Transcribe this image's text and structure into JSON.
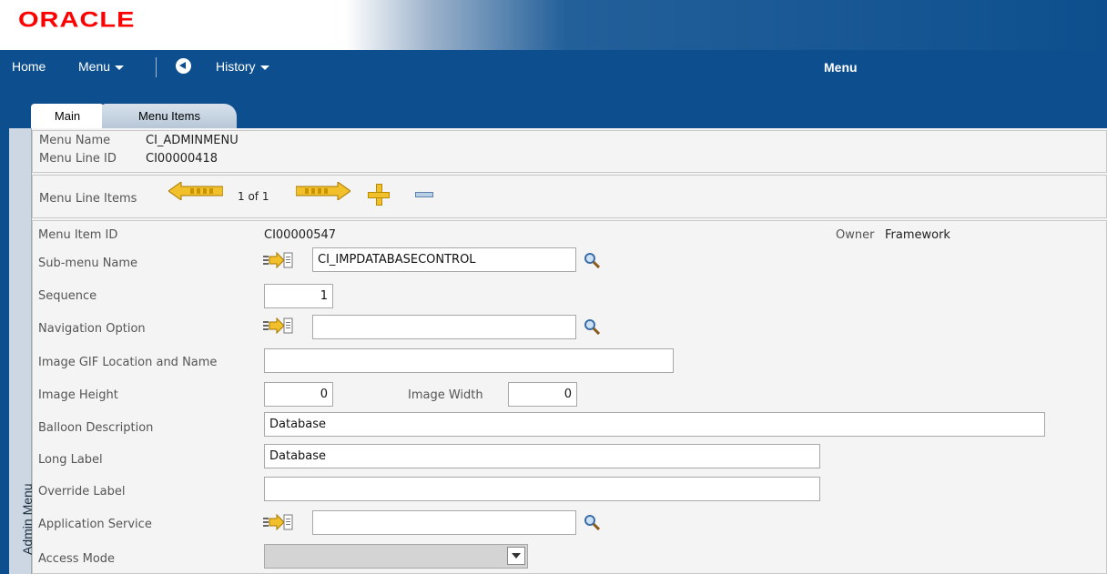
{
  "brand": {
    "logo": "ORACLE"
  },
  "nav": {
    "home": "Home",
    "menu": "Menu",
    "history": "History",
    "page_title": "Menu"
  },
  "tabs": [
    {
      "label": "Main"
    },
    {
      "label": "Menu Items"
    }
  ],
  "side_tab": {
    "label": "Admin Menu"
  },
  "header": {
    "menu_name_label": "Menu Name",
    "menu_name_value": "CI_ADMINMENU",
    "menu_line_id_label": "Menu Line ID",
    "menu_line_id_value": "CI00000418"
  },
  "line_items": {
    "label": "Menu Line Items",
    "pager": "1 of 1"
  },
  "form": {
    "menu_item_id_label": "Menu Item ID",
    "menu_item_id_value": "CI00000547",
    "owner_label": "Owner",
    "owner_value": "Framework",
    "submenu_label": "Sub-menu Name",
    "submenu_value": "CI_IMPDATABASECONTROL",
    "sequence_label": "Sequence",
    "sequence_value": "1",
    "nav_option_label": "Navigation Option",
    "nav_option_value": "",
    "image_gif_label": "Image GIF Location and Name",
    "image_gif_value": "",
    "image_height_label": "Image Height",
    "image_height_value": "0",
    "image_width_label": "Image Width",
    "image_width_value": "0",
    "balloon_label": "Balloon Description",
    "balloon_value": "Database",
    "long_label_label": "Long Label",
    "long_label_value": "Database",
    "override_label": "Override Label",
    "override_value": "",
    "app_service_label": "Application Service",
    "app_service_value": "",
    "access_mode_label": "Access Mode",
    "access_mode_value": ""
  },
  "colors": {
    "brand_red": "#ff0000",
    "nav_blue": "#0d4f8e",
    "arrow_gold": "#f2c02a"
  }
}
